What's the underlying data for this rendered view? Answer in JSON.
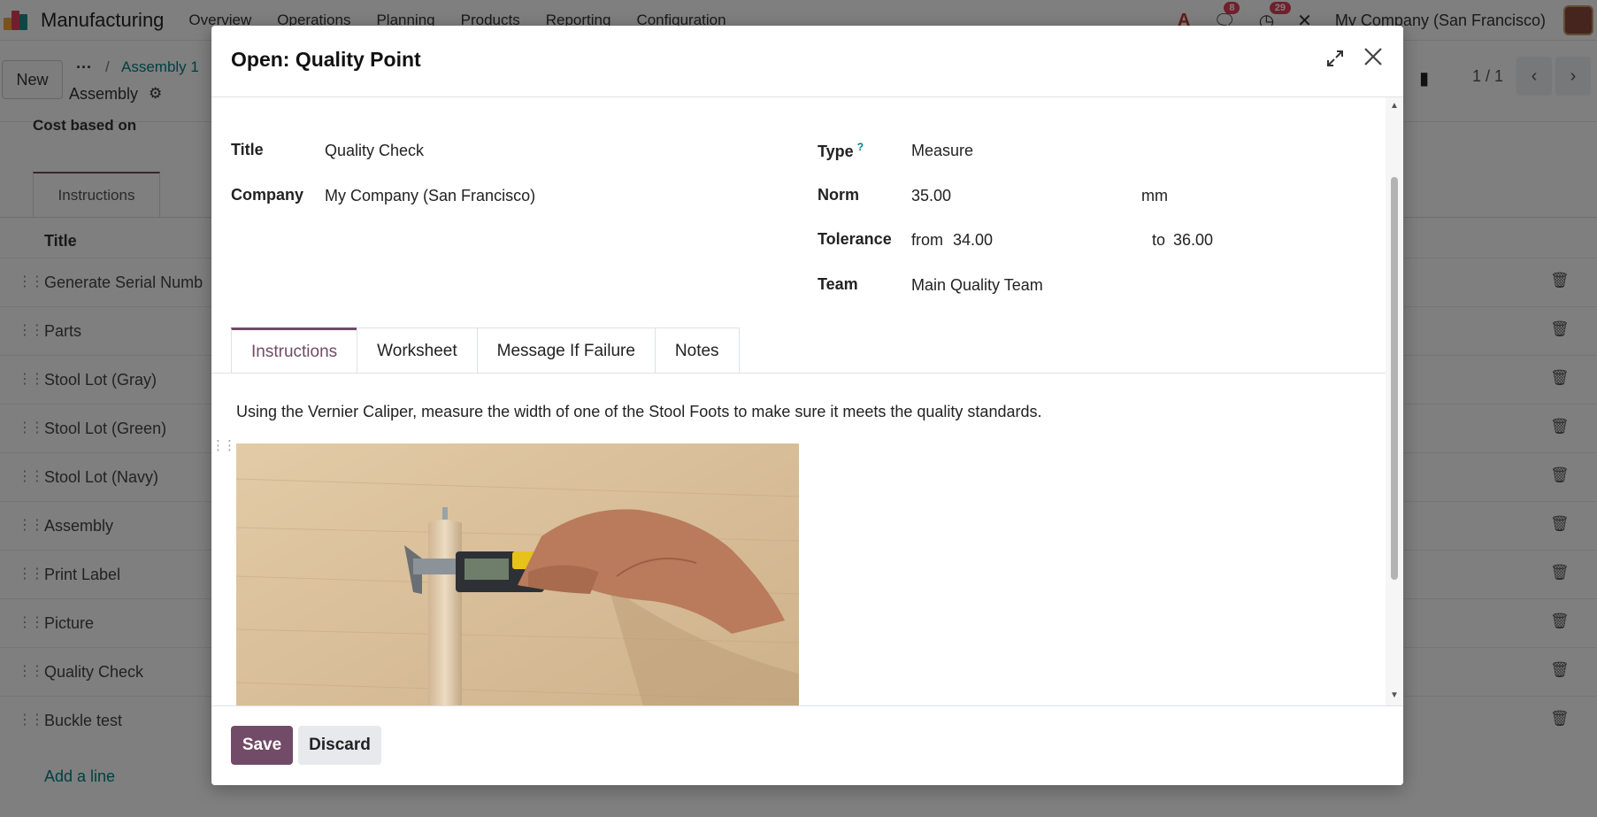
{
  "app": {
    "name": "Manufacturing",
    "menu": [
      "Overview",
      "Operations",
      "Planning",
      "Products",
      "Reporting",
      "Configuration"
    ],
    "chat_badge": "8",
    "activity_badge": "29",
    "company": "My Company (San Francisco)",
    "colors": {
      "brand": "#714b67",
      "link": "#017e84",
      "badge": "#e0405a"
    }
  },
  "controls": {
    "new_label": "New",
    "breadcrumb_dots": "···",
    "breadcrumb_sep": "/",
    "breadcrumb_parent": "Assembly 1",
    "breadcrumb_current": "Assembly",
    "pager": "1 / 1"
  },
  "bg_form": {
    "cost_label": "Cost based on",
    "tab": "Instructions",
    "column_title": "Title",
    "rows": [
      "Generate Serial Numb",
      "Parts",
      "Stool Lot (Gray)",
      "Stool Lot (Green)",
      "Stool Lot (Navy)",
      "Assembly",
      "Print Label",
      "Picture",
      "Quality Check",
      "Buckle test"
    ],
    "add_line": "Add a line"
  },
  "modal": {
    "title": "Open: Quality Point",
    "fields": {
      "title_label": "Title",
      "title_value": "Quality Check",
      "company_label": "Company",
      "company_value": "My Company (San Francisco)",
      "type_label": "Type",
      "type_help": "?",
      "type_value": "Measure",
      "norm_label": "Norm",
      "norm_value": "35.00",
      "norm_unit": "mm",
      "tolerance_label": "Tolerance",
      "tol_from_label": "from",
      "tol_from_value": "34.00",
      "tol_to_label": "to",
      "tol_to_value": "36.00",
      "team_label": "Team",
      "team_value": "Main Quality Team"
    },
    "tabs": [
      "Instructions",
      "Worksheet",
      "Message If Failure",
      "Notes"
    ],
    "active_tab": "Instructions",
    "instructions": "Using the Vernier Caliper, measure the width of one of the Stool Foots to make sure it meets the quality standards.",
    "save_label": "Save",
    "discard_label": "Discard"
  }
}
